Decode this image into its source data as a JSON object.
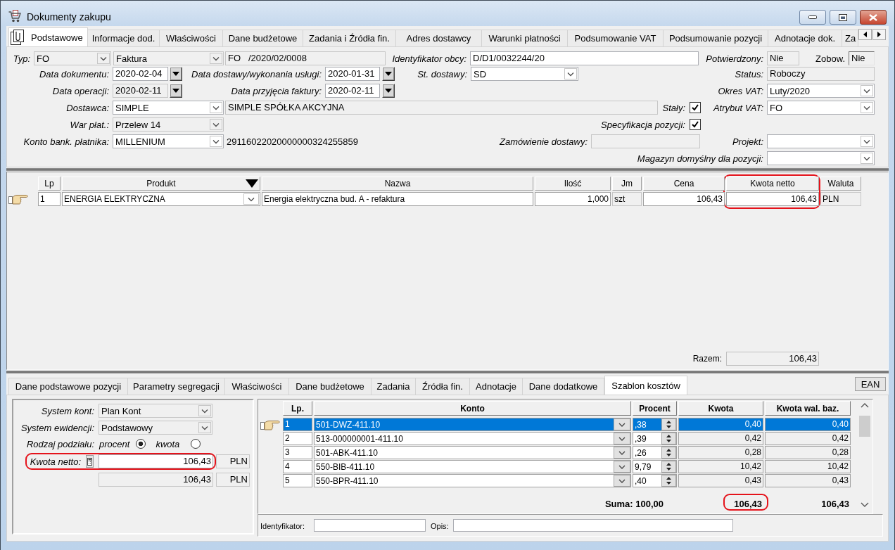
{
  "window": {
    "title": "Dokumenty zakupu"
  },
  "tabs": [
    {
      "label": "Podstawowe",
      "selected": true
    },
    {
      "label": "Informacje dod.",
      "selected": false
    },
    {
      "label": "Właściwości",
      "selected": false
    },
    {
      "label": "Dane budżetowe",
      "selected": false
    },
    {
      "label": "Zadania i Źródła fin.",
      "selected": false
    },
    {
      "label": "Adres dostawcy",
      "selected": false
    },
    {
      "label": "Warunki płatności",
      "selected": false
    },
    {
      "label": "Podsumowanie VAT",
      "selected": false
    },
    {
      "label": "Podsumowanie pozycji",
      "selected": false
    },
    {
      "label": "Adnotacje dok.",
      "selected": false
    },
    {
      "label": "Za",
      "selected": false
    }
  ],
  "form": {
    "type_label": "Typ:",
    "type_code": {
      "value": "FO",
      "disabled": true
    },
    "document_kind": {
      "value": "Faktura",
      "disabled": true
    },
    "document_number": {
      "value": "FO   /2020/02/0008",
      "disabled": true
    },
    "external_id": {
      "label": "Identyfikator obcy:",
      "value": "D/D1/0032244/20",
      "disabled": false
    },
    "confirmed": {
      "label": "Potwierdzony:",
      "value": "Nie",
      "disabled": true
    },
    "obligation": {
      "label": "Zobow.",
      "value": "Nie",
      "disabled": true
    },
    "document_date": {
      "label": "Data dokumentu:",
      "value": "2020-02-04",
      "disabled": false
    },
    "delivery_date": {
      "label": "Data dostawy/wykonania usługi:",
      "value": "2020-01-31",
      "disabled": false
    },
    "delivery_terms": {
      "label": "St. dostawy:",
      "value": "SD",
      "disabled": false
    },
    "status": {
      "label": "Status:",
      "value": "Roboczy",
      "disabled": true
    },
    "operation_date": {
      "label": "Data operacji:",
      "value": "2020-02-11",
      "disabled": true
    },
    "invoice_received_date": {
      "label": "Data przyjęcia faktury:",
      "value": "2020-02-11",
      "disabled": false
    },
    "vat_period": {
      "label": "Okres VAT:",
      "value": "Luty/2020",
      "disabled": false
    },
    "supplier": {
      "label": "Dostawca:",
      "value": "SIMPLE",
      "disabled": false
    },
    "supplier_name": {
      "value": "SIMPLE SPÓŁKA AKCYJNA",
      "disabled": true
    },
    "fixed": {
      "label": "Stały:",
      "checked": true
    },
    "vat_attribute": {
      "label": "Atrybut VAT:",
      "value": "FO",
      "disabled": false
    },
    "payment_terms": {
      "label": "War płat.:",
      "value": "Przelew 14",
      "disabled": true
    },
    "item_specification": {
      "label": "Specyfikacja pozycji:",
      "checked": true
    },
    "payer_bank_account": {
      "label": "Konto bank. płatnika:",
      "value": "MILLENIUM",
      "disabled": false
    },
    "bank_account_number": "29116022020000000324255859",
    "delivery_order": {
      "label": "Zamówienie dostawy:",
      "disabled": true
    },
    "project": {
      "label": "Projekt:",
      "disabled": false
    },
    "default_warehouse": {
      "label": "Magazyn domyślny dla pozycji:",
      "disabled": false
    }
  },
  "items": {
    "columns": [
      {
        "label": "Lp",
        "kind": "text",
        "highlighted": false
      },
      {
        "label": "Produkt",
        "kind": "combo",
        "highlighted": false
      },
      {
        "label": "Nazwa",
        "kind": "text",
        "highlighted": false
      },
      {
        "label": "Ilość",
        "kind": "number",
        "highlighted": false
      },
      {
        "label": "Jm",
        "kind": "readonly",
        "highlighted": false
      },
      {
        "label": "Cena",
        "kind": "number",
        "highlighted": false
      },
      {
        "label": "Kwota netto",
        "kind": "number",
        "highlighted": true
      },
      {
        "label": "Waluta",
        "kind": "readonly",
        "highlighted": false
      }
    ],
    "rows": [
      {
        "selected": true,
        "cells": [
          "1",
          "ENERGIA ELEKTRYCZNA",
          "Energia elektryczna bud. A - refaktura",
          "1,000",
          "szt",
          "106,43",
          "106,43",
          "PLN"
        ]
      }
    ],
    "total": {
      "label": "Razem:",
      "value": "106,43"
    }
  },
  "item_tabs": [
    {
      "label": "Dane podstawowe pozycji",
      "selected": false
    },
    {
      "label": "Parametry segregacji",
      "selected": false
    },
    {
      "label": "Właściwości",
      "selected": false
    },
    {
      "label": "Dane budżetowe",
      "selected": false
    },
    {
      "label": "Zadania",
      "selected": false
    },
    {
      "label": "Źródła fin.",
      "selected": false
    },
    {
      "label": "Adnotacje",
      "selected": false
    },
    {
      "label": "Dane dodatkowe",
      "selected": false
    },
    {
      "label": "Szablon kosztów",
      "selected": true
    }
  ],
  "ean_button": "EAN",
  "cost_template": {
    "account_system": {
      "label": "System kont:",
      "value": "Plan Kont",
      "disabled": true
    },
    "record_system": {
      "label": "System ewidencji:",
      "value": "Podstawowy",
      "disabled": true
    },
    "split_type": {
      "label": "Rodzaj podziału:",
      "options": [
        {
          "label": "procent",
          "selected": true
        },
        {
          "label": "kwota",
          "selected": false
        }
      ]
    },
    "net_amount": {
      "label": "Kwota netto:",
      "value": "106,43",
      "currency": "PLN",
      "disabled": false,
      "highlighted": true
    },
    "base_amount": {
      "value": "106,43",
      "currency": "PLN",
      "disabled": true
    },
    "table": {
      "columns": [
        "Lp.",
        "Konto",
        "Procent",
        "Kwota",
        "Kwota wal. baz."
      ],
      "rows": [
        {
          "lp": "1",
          "account": "501-DWZ-411.10",
          "percent": ",38",
          "amount": "0,40",
          "base_amount": "0,40",
          "selected": true
        },
        {
          "lp": "2",
          "account": "513-000000001-411.10",
          "percent": ",39",
          "amount": "0,42",
          "base_amount": "0,42",
          "selected": false
        },
        {
          "lp": "3",
          "account": "501-ABK-411.10",
          "percent": ",26",
          "amount": "0,28",
          "base_amount": "0,28",
          "selected": false
        },
        {
          "lp": "4",
          "account": "550-BIB-411.10",
          "percent": "9,79",
          "amount": "10,42",
          "base_amount": "10,42",
          "selected": false
        },
        {
          "lp": "5",
          "account": "550-BPR-411.10",
          "percent": ",40",
          "amount": "0,43",
          "base_amount": "0,43",
          "selected": false
        }
      ],
      "sum_label": "Suma: 100,00",
      "sum_amount": {
        "value": "106,43",
        "highlighted": true
      },
      "sum_base_amount": "106,43"
    },
    "identifier": {
      "label": "Identyfikator:"
    },
    "description": {
      "label": "Opis:"
    }
  }
}
